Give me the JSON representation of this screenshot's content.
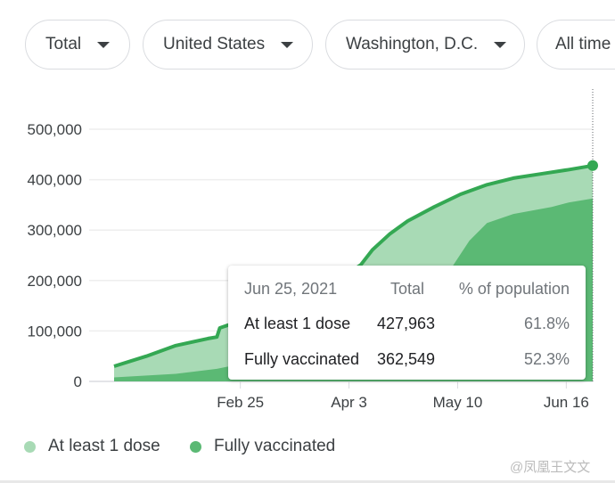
{
  "filters": [
    {
      "label": "Total"
    },
    {
      "label": "United States"
    },
    {
      "label": "Washington, D.C."
    },
    {
      "label": "All time"
    }
  ],
  "colors": {
    "dose1": "#a8dab5",
    "full": "#5bb974",
    "line": "#34a853"
  },
  "tooltip": {
    "date": "Jun 25, 2021",
    "col_total": "Total",
    "col_pct": "% of population",
    "rows": [
      {
        "label": "At least 1 dose",
        "total": "427,963",
        "pct": "61.8%"
      },
      {
        "label": "Fully vaccinated",
        "total": "362,549",
        "pct": "52.3%"
      }
    ]
  },
  "watermark": "@凤凰王文文",
  "chart_data": {
    "type": "area",
    "ylim": [
      0,
      500000
    ],
    "yticks": [
      "500,000",
      "400,000",
      "300,000",
      "200,000",
      "100,000",
      "0"
    ],
    "ytick_values": [
      500000,
      400000,
      300000,
      200000,
      100000,
      0
    ],
    "xticks": [
      {
        "label": "Feb 25",
        "date": "2021-02-25"
      },
      {
        "label": "Apr 3",
        "date": "2021-04-03"
      },
      {
        "label": "May 10",
        "date": "2021-05-10"
      },
      {
        "label": "Jun 16",
        "date": "2021-06-16"
      }
    ],
    "xlim": [
      "2021-01-13",
      "2021-06-25"
    ],
    "grid": true,
    "legend": "bottom-left",
    "series": [
      {
        "name": "At least 1 dose",
        "points": [
          [
            "2021-01-13",
            0
          ],
          [
            "2021-01-13",
            30000
          ],
          [
            "2021-01-24",
            50000
          ],
          [
            "2021-02-03",
            71000
          ],
          [
            "2021-02-14",
            85000
          ],
          [
            "2021-02-17",
            88000
          ],
          [
            "2021-02-18",
            106000
          ],
          [
            "2021-02-25",
            120000
          ],
          [
            "2021-03-06",
            140000
          ],
          [
            "2021-03-21",
            170000
          ],
          [
            "2021-03-30",
            200000
          ],
          [
            "2021-04-07",
            231000
          ],
          [
            "2021-04-11",
            261000
          ],
          [
            "2021-04-17",
            293000
          ],
          [
            "2021-04-23",
            318000
          ],
          [
            "2021-05-02",
            346000
          ],
          [
            "2021-05-11",
            371000
          ],
          [
            "2021-05-20",
            390000
          ],
          [
            "2021-05-29",
            403000
          ],
          [
            "2021-06-08",
            412000
          ],
          [
            "2021-06-17",
            420000
          ],
          [
            "2021-06-25",
            427963
          ]
        ]
      },
      {
        "name": "Fully vaccinated",
        "points": [
          [
            "2021-01-13",
            0
          ],
          [
            "2021-01-13",
            8000
          ],
          [
            "2021-02-03",
            15000
          ],
          [
            "2021-02-17",
            25000
          ],
          [
            "2021-03-06",
            45000
          ],
          [
            "2021-03-21",
            70000
          ],
          [
            "2021-04-07",
            110000
          ],
          [
            "2021-04-23",
            170000
          ],
          [
            "2021-05-08",
            226000
          ],
          [
            "2021-05-14",
            279000
          ],
          [
            "2021-05-20",
            314000
          ],
          [
            "2021-05-29",
            332000
          ],
          [
            "2021-06-11",
            346000
          ],
          [
            "2021-06-17",
            355000
          ],
          [
            "2021-06-25",
            362549
          ]
        ]
      }
    ]
  }
}
